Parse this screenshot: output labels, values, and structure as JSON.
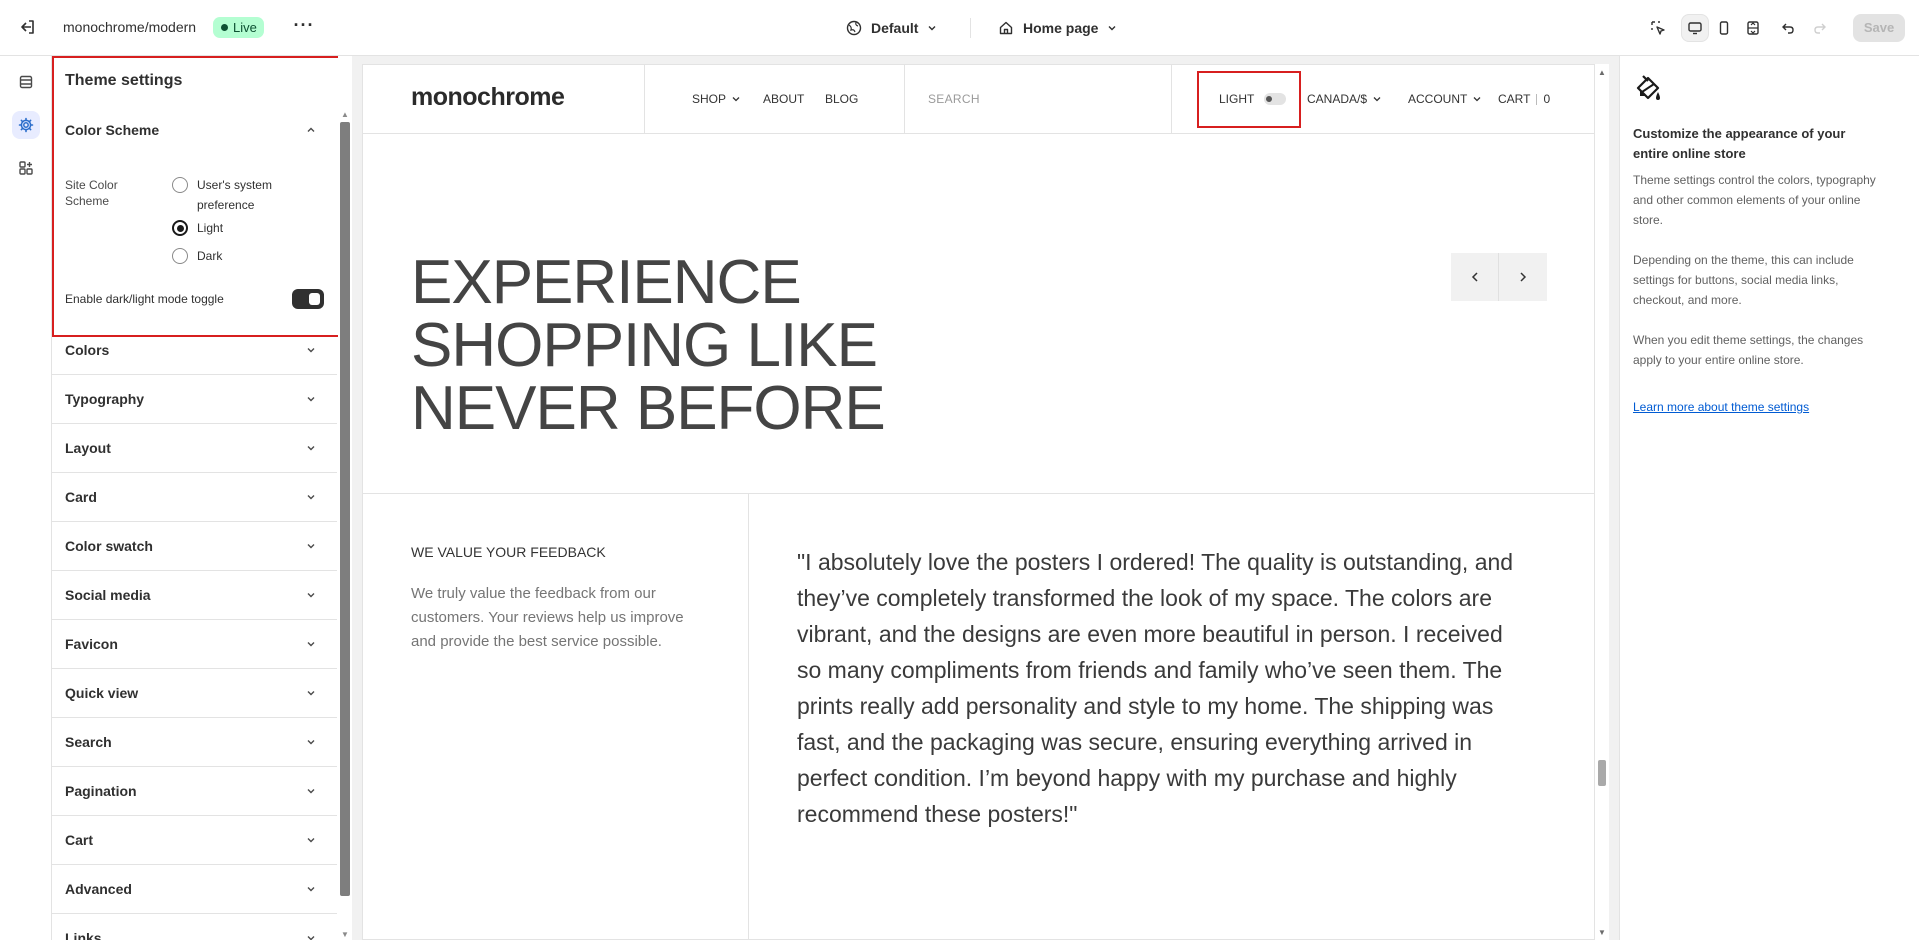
{
  "topbar": {
    "store_name": "monochrome/modern",
    "status_badge": "Live",
    "theme_selector": "Default",
    "page_selector": "Home page",
    "save_label": "Save"
  },
  "settings_panel": {
    "title": "Theme settings",
    "color_scheme": {
      "heading": "Color Scheme",
      "field_label": "Site Color Scheme",
      "options": [
        "User's system preference",
        "Light",
        "Dark"
      ],
      "selected": "Light",
      "toggle_label": "Enable dark/light mode toggle",
      "toggle_on": true
    },
    "sections": [
      "Colors",
      "Typography",
      "Layout",
      "Card",
      "Color swatch",
      "Social media",
      "Favicon",
      "Quick view",
      "Search",
      "Pagination",
      "Cart",
      "Advanced",
      "Links"
    ]
  },
  "preview": {
    "logo": "monochrome",
    "nav": [
      "SHOP",
      "ABOUT",
      "BLOG"
    ],
    "search_placeholder": "SEARCH",
    "mode_toggle_label": "LIGHT",
    "currency": "CANADA/$",
    "account": "ACCOUNT",
    "cart_label": "CART",
    "cart_count": "0",
    "hero_title": "EXPERIENCE SHOPPING LIKE NEVER BEFORE",
    "feedback_title": "WE VALUE YOUR FEEDBACK",
    "feedback_body": "We truly value the feedback from our customers. Your reviews help us improve and provide the best service possible.",
    "testimonial": "\"I absolutely love the posters I ordered! The quality is outstanding, and they’ve completely transformed the look of my space. The colors are vibrant, and the designs are even more beautiful in person. I received so many compliments from friends and family who’ve seen them. The prints really add personality and style to my home. The shipping was fast, and the packaging was secure, ensuring everything arrived in perfect condition. I’m beyond happy with my purchase and highly recommend these posters!\""
  },
  "info_panel": {
    "heading": "Customize the appearance of your entire online store",
    "p1": "Theme settings control the colors, typography and other common elements of your online store.",
    "p2": "Depending on the theme, this can include settings for buttons, social media links, checkout, and more.",
    "p3": "When you edit theme settings, the changes apply to your entire online store.",
    "link": "Learn more about theme settings"
  },
  "colors": {
    "highlight": "#d71f1f",
    "live_badge_bg": "#b4fed2",
    "link": "#005bd3"
  }
}
